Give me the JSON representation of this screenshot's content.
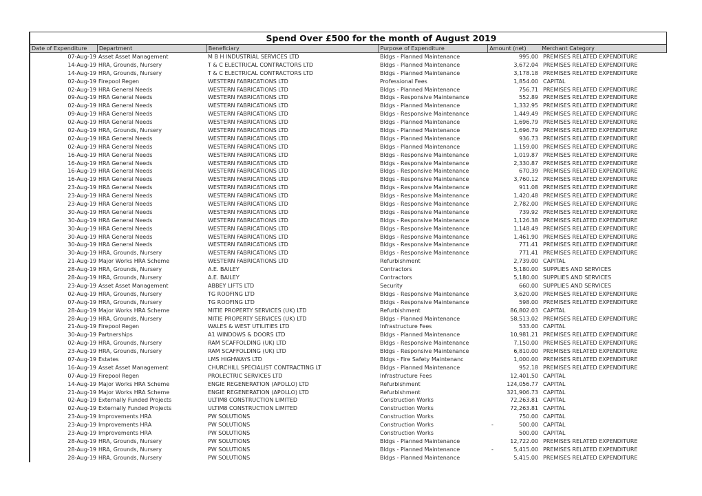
{
  "title": "Spend Over £500 for the month of August 2019",
  "columns": [
    "Date of Expenditure",
    "Department",
    "Beneficiary",
    "Purpose of Expenditure",
    "Amount (net)",
    "Merchant Category"
  ],
  "rows": [
    {
      "date": "07-Aug-19",
      "dept": "Asset Asset Management",
      "beneficiary": "M B H INDUSTRIAL SERVICES LTD",
      "purpose": "Bldgs - Planned Maintenance",
      "sign": "",
      "amount": "995.00",
      "category": "PREMISES RELATED EXPENDITURE"
    },
    {
      "date": "14-Aug-19",
      "dept": "HRA, Grounds, Nursery",
      "beneficiary": "T & C ELECTRICAL CONTRACTORS LTD",
      "purpose": "Bldgs - Planned Maintenance",
      "sign": "",
      "amount": "3,672.04",
      "category": "PREMISES RELATED EXPENDITURE"
    },
    {
      "date": "14-Aug-19",
      "dept": "HRA, Grounds, Nursery",
      "beneficiary": "T & C ELECTRICAL CONTRACTORS LTD",
      "purpose": "Bldgs - Planned Maintenance",
      "sign": "",
      "amount": "3,178.18",
      "category": "PREMISES RELATED EXPENDITURE"
    },
    {
      "date": "02-Aug-19",
      "dept": "Firepool Regen",
      "beneficiary": "WESTERN FABRICATIONS LTD",
      "purpose": "Professional Fees",
      "sign": "",
      "amount": "1,854.00",
      "category": "CAPITAL"
    },
    {
      "date": "02-Aug-19",
      "dept": "HRA General Needs",
      "beneficiary": "WESTERN FABRICATIONS LTD",
      "purpose": "Bldgs - Planned Maintenance",
      "sign": "",
      "amount": "756.71",
      "category": "PREMISES RELATED EXPENDITURE"
    },
    {
      "date": "09-Aug-19",
      "dept": "HRA General Needs",
      "beneficiary": "WESTERN FABRICATIONS LTD",
      "purpose": "Bldgs - Responsive Maintenance",
      "sign": "",
      "amount": "552.89",
      "category": "PREMISES RELATED EXPENDITURE"
    },
    {
      "date": "02-Aug-19",
      "dept": "HRA General Needs",
      "beneficiary": "WESTERN FABRICATIONS LTD",
      "purpose": "Bldgs - Planned Maintenance",
      "sign": "",
      "amount": "1,332.95",
      "category": "PREMISES RELATED EXPENDITURE"
    },
    {
      "date": "09-Aug-19",
      "dept": "HRA General Needs",
      "beneficiary": "WESTERN FABRICATIONS LTD",
      "purpose": "Bldgs - Responsive Maintenance",
      "sign": "",
      "amount": "1,449.49",
      "category": "PREMISES RELATED EXPENDITURE"
    },
    {
      "date": "02-Aug-19",
      "dept": "HRA General Needs",
      "beneficiary": "WESTERN FABRICATIONS LTD",
      "purpose": "Bldgs - Planned Maintenance",
      "sign": "",
      "amount": "1,696.79",
      "category": "PREMISES RELATED EXPENDITURE"
    },
    {
      "date": "02-Aug-19",
      "dept": "HRA, Grounds, Nursery",
      "beneficiary": "WESTERN FABRICATIONS LTD",
      "purpose": "Bldgs - Planned Maintenance",
      "sign": "",
      "amount": "1,696.79",
      "category": "PREMISES RELATED EXPENDITURE"
    },
    {
      "date": "02-Aug-19",
      "dept": "HRA General Needs",
      "beneficiary": "WESTERN FABRICATIONS LTD",
      "purpose": "Bldgs - Planned Maintenance",
      "sign": "",
      "amount": "936.73",
      "category": "PREMISES RELATED EXPENDITURE"
    },
    {
      "date": "02-Aug-19",
      "dept": "HRA General Needs",
      "beneficiary": "WESTERN FABRICATIONS LTD",
      "purpose": "Bldgs - Planned Maintenance",
      "sign": "",
      "amount": "1,159.00",
      "category": "PREMISES RELATED EXPENDITURE"
    },
    {
      "date": "16-Aug-19",
      "dept": "HRA General Needs",
      "beneficiary": "WESTERN FABRICATIONS LTD",
      "purpose": "Bldgs - Responsive Maintenance",
      "sign": "",
      "amount": "1,019.87",
      "category": "PREMISES RELATED EXPENDITURE"
    },
    {
      "date": "16-Aug-19",
      "dept": "HRA General Needs",
      "beneficiary": "WESTERN FABRICATIONS LTD",
      "purpose": "Bldgs - Responsive Maintenance",
      "sign": "",
      "amount": "2,330.87",
      "category": "PREMISES RELATED EXPENDITURE"
    },
    {
      "date": "16-Aug-19",
      "dept": "HRA General Needs",
      "beneficiary": "WESTERN FABRICATIONS LTD",
      "purpose": "Bldgs - Responsive Maintenance",
      "sign": "",
      "amount": "670.39",
      "category": "PREMISES RELATED EXPENDITURE"
    },
    {
      "date": "16-Aug-19",
      "dept": "HRA General Needs",
      "beneficiary": "WESTERN FABRICATIONS LTD",
      "purpose": "Bldgs - Responsive Maintenance",
      "sign": "",
      "amount": "3,760.12",
      "category": "PREMISES RELATED EXPENDITURE"
    },
    {
      "date": "23-Aug-19",
      "dept": "HRA General Needs",
      "beneficiary": "WESTERN FABRICATIONS LTD",
      "purpose": "Bldgs - Responsive Maintenance",
      "sign": "",
      "amount": "911.08",
      "category": "PREMISES RELATED EXPENDITURE"
    },
    {
      "date": "23-Aug-19",
      "dept": "HRA General Needs",
      "beneficiary": "WESTERN FABRICATIONS LTD",
      "purpose": "Bldgs - Responsive Maintenance",
      "sign": "",
      "amount": "1,420.48",
      "category": "PREMISES RELATED EXPENDITURE"
    },
    {
      "date": "23-Aug-19",
      "dept": "HRA General Needs",
      "beneficiary": "WESTERN FABRICATIONS LTD",
      "purpose": "Bldgs - Responsive Maintenance",
      "sign": "",
      "amount": "2,782.00",
      "category": "PREMISES RELATED EXPENDITURE"
    },
    {
      "date": "30-Aug-19",
      "dept": "HRA General Needs",
      "beneficiary": "WESTERN FABRICATIONS LTD",
      "purpose": "Bldgs - Responsive Maintenance",
      "sign": "",
      "amount": "739.92",
      "category": "PREMISES RELATED EXPENDITURE"
    },
    {
      "date": "30-Aug-19",
      "dept": "HRA General Needs",
      "beneficiary": "WESTERN FABRICATIONS LTD",
      "purpose": "Bldgs - Responsive Maintenance",
      "sign": "",
      "amount": "1,126.38",
      "category": "PREMISES RELATED EXPENDITURE"
    },
    {
      "date": "30-Aug-19",
      "dept": "HRA General Needs",
      "beneficiary": "WESTERN FABRICATIONS LTD",
      "purpose": "Bldgs - Responsive Maintenance",
      "sign": "",
      "amount": "1,148.49",
      "category": "PREMISES RELATED EXPENDITURE"
    },
    {
      "date": "30-Aug-19",
      "dept": "HRA General Needs",
      "beneficiary": "WESTERN FABRICATIONS LTD",
      "purpose": "Bldgs - Responsive Maintenance",
      "sign": "",
      "amount": "1,461.90",
      "category": "PREMISES RELATED EXPENDITURE"
    },
    {
      "date": "30-Aug-19",
      "dept": "HRA General Needs",
      "beneficiary": "WESTERN FABRICATIONS LTD",
      "purpose": "Bldgs - Responsive Maintenance",
      "sign": "",
      "amount": "771.41",
      "category": "PREMISES RELATED EXPENDITURE"
    },
    {
      "date": "30-Aug-19",
      "dept": "HRA, Grounds, Nursery",
      "beneficiary": "WESTERN FABRICATIONS LTD",
      "purpose": "Bldgs - Responsive Maintenance",
      "sign": "",
      "amount": "771.41",
      "category": "PREMISES RELATED EXPENDITURE"
    },
    {
      "date": "21-Aug-19",
      "dept": "Major Works HRA Scheme",
      "beneficiary": "WESTERN FABRICATIONS LTD",
      "purpose": "Refurbishment",
      "sign": "",
      "amount": "2,739.00",
      "category": "CAPITAL"
    },
    {
      "date": "28-Aug-19",
      "dept": "HRA, Grounds, Nursery",
      "beneficiary": "A.E. BAILEY",
      "purpose": "Contractors",
      "sign": "",
      "amount": "5,180.00",
      "category": "SUPPLIES AND SERVICES"
    },
    {
      "date": "28-Aug-19",
      "dept": "HRA, Grounds, Nursery",
      "beneficiary": "A.E. BAILEY",
      "purpose": "Contractors",
      "sign": "",
      "amount": "5,180.00",
      "category": "SUPPLIES AND SERVICES"
    },
    {
      "date": "23-Aug-19",
      "dept": "Asset Asset Management",
      "beneficiary": "ABBEY LIFTS LTD",
      "purpose": "Security",
      "sign": "",
      "amount": "660.00",
      "category": "SUPPLIES AND SERVICES"
    },
    {
      "date": "02-Aug-19",
      "dept": "HRA, Grounds, Nursery",
      "beneficiary": "TG ROOFING LTD",
      "purpose": "Bldgs - Responsive Maintenance",
      "sign": "",
      "amount": "3,620.00",
      "category": "PREMISES RELATED EXPENDITURE"
    },
    {
      "date": "07-Aug-19",
      "dept": "HRA, Grounds, Nursery",
      "beneficiary": "TG ROOFING LTD",
      "purpose": "Bldgs - Responsive Maintenance",
      "sign": "",
      "amount": "598.00",
      "category": "PREMISES RELATED EXPENDITURE"
    },
    {
      "date": "28-Aug-19",
      "dept": "Major Works HRA Scheme",
      "beneficiary": "MITIE PROPERTY SERVICES (UK) LTD",
      "purpose": "Refurbishment",
      "sign": "",
      "amount": "86,802.03",
      "category": "CAPITAL"
    },
    {
      "date": "28-Aug-19",
      "dept": "HRA, Grounds, Nursery",
      "beneficiary": "MITIE PROPERTY SERVICES (UK) LTD",
      "purpose": "Bldgs - Planned Maintenance",
      "sign": "",
      "amount": "58,513.02",
      "category": "PREMISES RELATED EXPENDITURE"
    },
    {
      "date": "21-Aug-19",
      "dept": "Firepool Regen",
      "beneficiary": "WALES & WEST UTILITIES LTD",
      "purpose": "Infrastructure Fees",
      "sign": "",
      "amount": "533.00",
      "category": "CAPITAL"
    },
    {
      "date": "30-Aug-19",
      "dept": "Partnerships",
      "beneficiary": "A1 WINDOWS & DOORS LTD",
      "purpose": "Bldgs - Planned Maintenance",
      "sign": "",
      "amount": "10,981.21",
      "category": "PREMISES RELATED EXPENDITURE"
    },
    {
      "date": "02-Aug-19",
      "dept": "HRA, Grounds, Nursery",
      "beneficiary": "RAM SCAFFOLDING (UK) LTD",
      "purpose": "Bldgs - Responsive Maintenance",
      "sign": "",
      "amount": "7,150.00",
      "category": "PREMISES RELATED EXPENDITURE"
    },
    {
      "date": "23-Aug-19",
      "dept": "HRA, Grounds, Nursery",
      "beneficiary": "RAM SCAFFOLDING (UK) LTD",
      "purpose": "Bldgs - Responsive Maintenance",
      "sign": "",
      "amount": "6,810.00",
      "category": "PREMISES RELATED EXPENDITURE"
    },
    {
      "date": "07-Aug-19",
      "dept": "Estates",
      "beneficiary": "LMS HIGHWAYS LTD",
      "purpose": "Bldgs - Fire Safety Maintenanc",
      "sign": "",
      "amount": "1,000.00",
      "category": "PREMISES RELATED EXPENDITURE"
    },
    {
      "date": "16-Aug-19",
      "dept": "Asset Asset Management",
      "beneficiary": "CHURCHILL SPECIALIST CONTRACTING LT",
      "purpose": "Bldgs - Planned Maintenance",
      "sign": "",
      "amount": "952.18",
      "category": "PREMISES RELATED EXPENDITURE"
    },
    {
      "date": "07-Aug-19",
      "dept": "Firepool Regen",
      "beneficiary": "PROLECTRIC SERVICES LTD",
      "purpose": "Infrastructure Fees",
      "sign": "",
      "amount": "12,401.50",
      "category": "CAPITAL"
    },
    {
      "date": "14-Aug-19",
      "dept": "Major Works HRA Scheme",
      "beneficiary": "ENGIE REGENERATION (APOLLO) LTD",
      "purpose": "Refurbishment",
      "sign": "",
      "amount": "124,056.77",
      "category": "CAPITAL"
    },
    {
      "date": "21-Aug-19",
      "dept": "Major Works HRA Scheme",
      "beneficiary": "ENGIE REGENERATION (APOLLO) LTD",
      "purpose": "Refurbishment",
      "sign": "",
      "amount": "321,906.73",
      "category": "CAPITAL"
    },
    {
      "date": "02-Aug-19",
      "dept": "Externally Funded Projects",
      "beneficiary": "ULTIM8 CONSTRUCTION LIMITED",
      "purpose": "Construction Works",
      "sign": "",
      "amount": "72,263.81",
      "category": "CAPITAL"
    },
    {
      "date": "02-Aug-19",
      "dept": "Externally Funded Projects",
      "beneficiary": "ULTIM8 CONSTRUCTION LIMITED",
      "purpose": "Construction Works",
      "sign": "",
      "amount": "72,263.81",
      "category": "CAPITAL"
    },
    {
      "date": "23-Aug-19",
      "dept": "Improvements HRA",
      "beneficiary": "PW SOLUTIONS",
      "purpose": "Construction Works",
      "sign": "",
      "amount": "750.00",
      "category": "CAPITAL"
    },
    {
      "date": "23-Aug-19",
      "dept": "Improvements HRA",
      "beneficiary": "PW SOLUTIONS",
      "purpose": "Construction Works",
      "sign": "-",
      "amount": "500.00",
      "category": "CAPITAL"
    },
    {
      "date": "23-Aug-19",
      "dept": "Improvements HRA",
      "beneficiary": "PW SOLUTIONS",
      "purpose": "Construction Works",
      "sign": "",
      "amount": "500.00",
      "category": "CAPITAL"
    },
    {
      "date": "28-Aug-19",
      "dept": "HRA, Grounds, Nursery",
      "beneficiary": "PW SOLUTIONS",
      "purpose": "Bldgs - Planned Maintenance",
      "sign": "",
      "amount": "12,722.00",
      "category": "PREMISES RELATED EXPENDITURE"
    },
    {
      "date": "28-Aug-19",
      "dept": "HRA, Grounds, Nursery",
      "beneficiary": "PW SOLUTIONS",
      "purpose": "Bldgs - Planned Maintenance",
      "sign": "-",
      "amount": "5,415.00",
      "category": "PREMISES RELATED EXPENDITURE"
    },
    {
      "date": "28-Aug-19",
      "dept": "HRA, Grounds, Nursery",
      "beneficiary": "PW SOLUTIONS",
      "purpose": "Bldgs - Planned Maintenance",
      "sign": "",
      "amount": "5,415.00",
      "category": "PREMISES RELATED EXPENDITURE"
    }
  ]
}
